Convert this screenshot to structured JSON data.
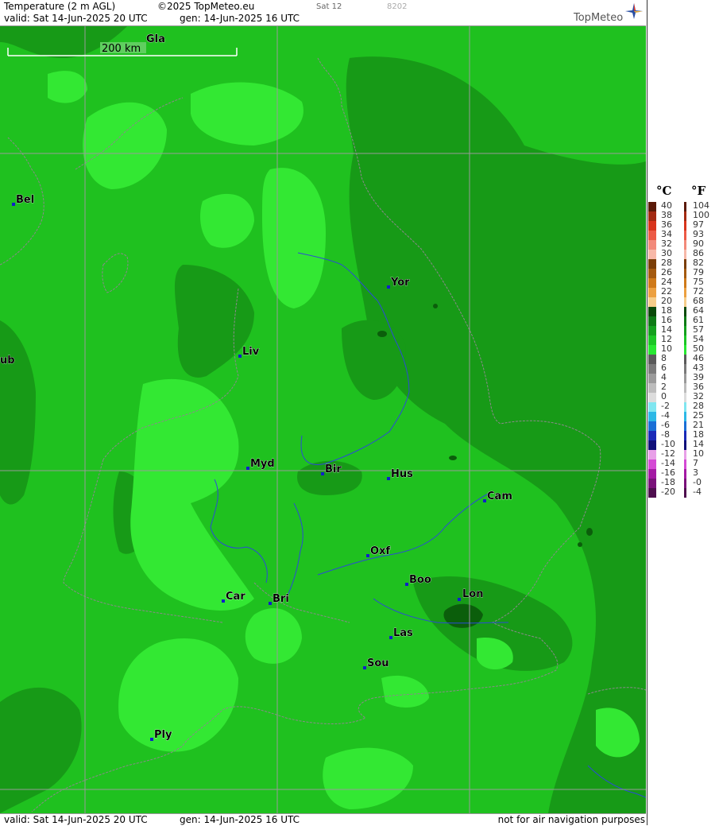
{
  "header": {
    "title": "Temperature (2 m AGL)",
    "copyright": "©2025 TopMeteo.eu",
    "day_code": "Sat 12",
    "code": "8202",
    "valid": "valid:  Sat  14-Jun-2025   20 UTC",
    "generated": "gen: 14-Jun-2025 16 UTC",
    "brand": "TopMeteo"
  },
  "footer": {
    "valid": "valid:  Sat  14-Jun-2025   20 UTC",
    "generated": "gen: 14-Jun-2025 16 UTC",
    "disclaimer": "not for air navigation purposes"
  },
  "scale_bar": {
    "label": "200 km"
  },
  "cities": [
    {
      "label": "Gla"
    },
    {
      "label": "Bel"
    },
    {
      "label": "Yor"
    },
    {
      "label": "Liv"
    },
    {
      "label": "ub"
    },
    {
      "label": "Myd"
    },
    {
      "label": "Bir"
    },
    {
      "label": "Hus"
    },
    {
      "label": "Cam"
    },
    {
      "label": "Oxf"
    },
    {
      "label": "Boo"
    },
    {
      "label": "Lon"
    },
    {
      "label": "Car"
    },
    {
      "label": "Bri"
    },
    {
      "label": "Las"
    },
    {
      "label": "Sou"
    },
    {
      "label": "Ply"
    }
  ],
  "legend": {
    "celsius_unit": "°C",
    "fahrenheit_unit": "°F",
    "celsius_labels": [
      "40",
      "38",
      "36",
      "34",
      "32",
      "30",
      "28",
      "26",
      "24",
      "22",
      "20",
      "18",
      "16",
      "14",
      "12",
      "10",
      "8",
      "6",
      "4",
      "2",
      "0",
      "-2",
      "-4",
      "-6",
      "-8",
      "-10",
      "-12",
      "-14",
      "-16",
      "-18",
      "-20"
    ],
    "fahrenheit_labels": [
      "104",
      "100",
      "97",
      "93",
      "90",
      "86",
      "82",
      "79",
      "75",
      "72",
      "68",
      "64",
      "61",
      "57",
      "54",
      "50",
      "46",
      "43",
      "39",
      "36",
      "32",
      "28",
      "25",
      "21",
      "18",
      "14",
      "10",
      "7",
      "3",
      "-0",
      "-4"
    ],
    "colors": [
      "#5a1a08",
      "#a32a12",
      "#d8341c",
      "#ec5a46",
      "#f28a7a",
      "#f7b8a8",
      "#7a3e08",
      "#a45a10",
      "#cf7a1a",
      "#eca040",
      "#f6cd8a",
      "#0a4a0a",
      "#0e7a16",
      "#14a01e",
      "#1cc626",
      "#28e832",
      "#5a5a5a",
      "#7a7a7a",
      "#9a9a9a",
      "#bcbcbc",
      "#dcdcdc",
      "#80e6f0",
      "#2cb8e6",
      "#1a6fd6",
      "#1a2ab8",
      "#10107a",
      "#e8a0e8",
      "#d44ad4",
      "#a41aa4",
      "#7a127a",
      "#4e0e4e"
    ]
  },
  "map_colors": {
    "base": "#1fc11f",
    "warm_light": "#33e833",
    "cool_dark": "#179a17",
    "darkest": "#0b5e0b",
    "river": "#2b4bd6",
    "coast": "#8a8a8a",
    "grid": "#9a9a9a"
  }
}
